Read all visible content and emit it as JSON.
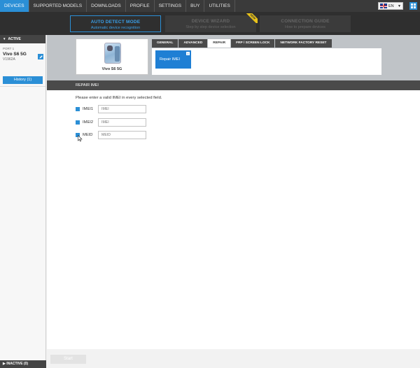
{
  "topbar": {
    "items": [
      {
        "label": "DEVICES",
        "active": true
      },
      {
        "label": "SUPPORTED MODELS",
        "active": false
      },
      {
        "label": "DOWNLOADS",
        "active": false
      },
      {
        "label": "PROFILE",
        "active": false
      },
      {
        "label": "SETTINGS",
        "active": false
      },
      {
        "label": "BUY",
        "active": false
      },
      {
        "label": "UTILITIES",
        "active": false
      }
    ],
    "language": "EN",
    "language_icon": "uk-flag-icon",
    "menu_icon": "grid-menu-icon"
  },
  "modes": {
    "auto_detect": {
      "title": "AUTO DETECT MODE",
      "subtitle": "Automatic device recognition"
    },
    "wizard": {
      "title": "DEVICE WIZARD",
      "subtitle": "Step by step device selection",
      "badge": "NEW"
    },
    "guide": {
      "title": "CONNECTION GUIDE",
      "subtitle": "How to prepare devices"
    }
  },
  "sidebar": {
    "active_label": "ACTIVE",
    "port": "PORT 1",
    "device_name": "Vivo S6 5G",
    "device_model": "V1962A",
    "history_label": "History (1)",
    "inactive_label": "INACTIVE (0)"
  },
  "device": {
    "label": "Vivo S6 5G"
  },
  "tabs": [
    {
      "label": "GENERAL",
      "active": false
    },
    {
      "label": "ADVANCED",
      "active": false
    },
    {
      "label": "REPAIR",
      "active": true
    },
    {
      "label": "FRP / SCREEN LOCK",
      "active": false
    },
    {
      "label": "NETWORK FACTORY RESET",
      "active": false
    }
  ],
  "actions": {
    "repair_imei": "Repair IMEI",
    "info_glyph": "i"
  },
  "repair": {
    "section_title": "REPAIR IMEI",
    "hint": "Please enter a valid IMEI in every selected field.",
    "fields": [
      {
        "label": "IMEI1",
        "placeholder": "IMEI",
        "checked": true
      },
      {
        "label": "IMEI2",
        "placeholder": "IMEI",
        "checked": true
      },
      {
        "label": "MEID",
        "placeholder": "MEID",
        "checked": true
      }
    ]
  },
  "footer": {
    "start_label": "Start"
  },
  "colors": {
    "accent": "#2b8fd6",
    "topbar": "#3a3a3a",
    "section_header": "#4a4a4a"
  }
}
